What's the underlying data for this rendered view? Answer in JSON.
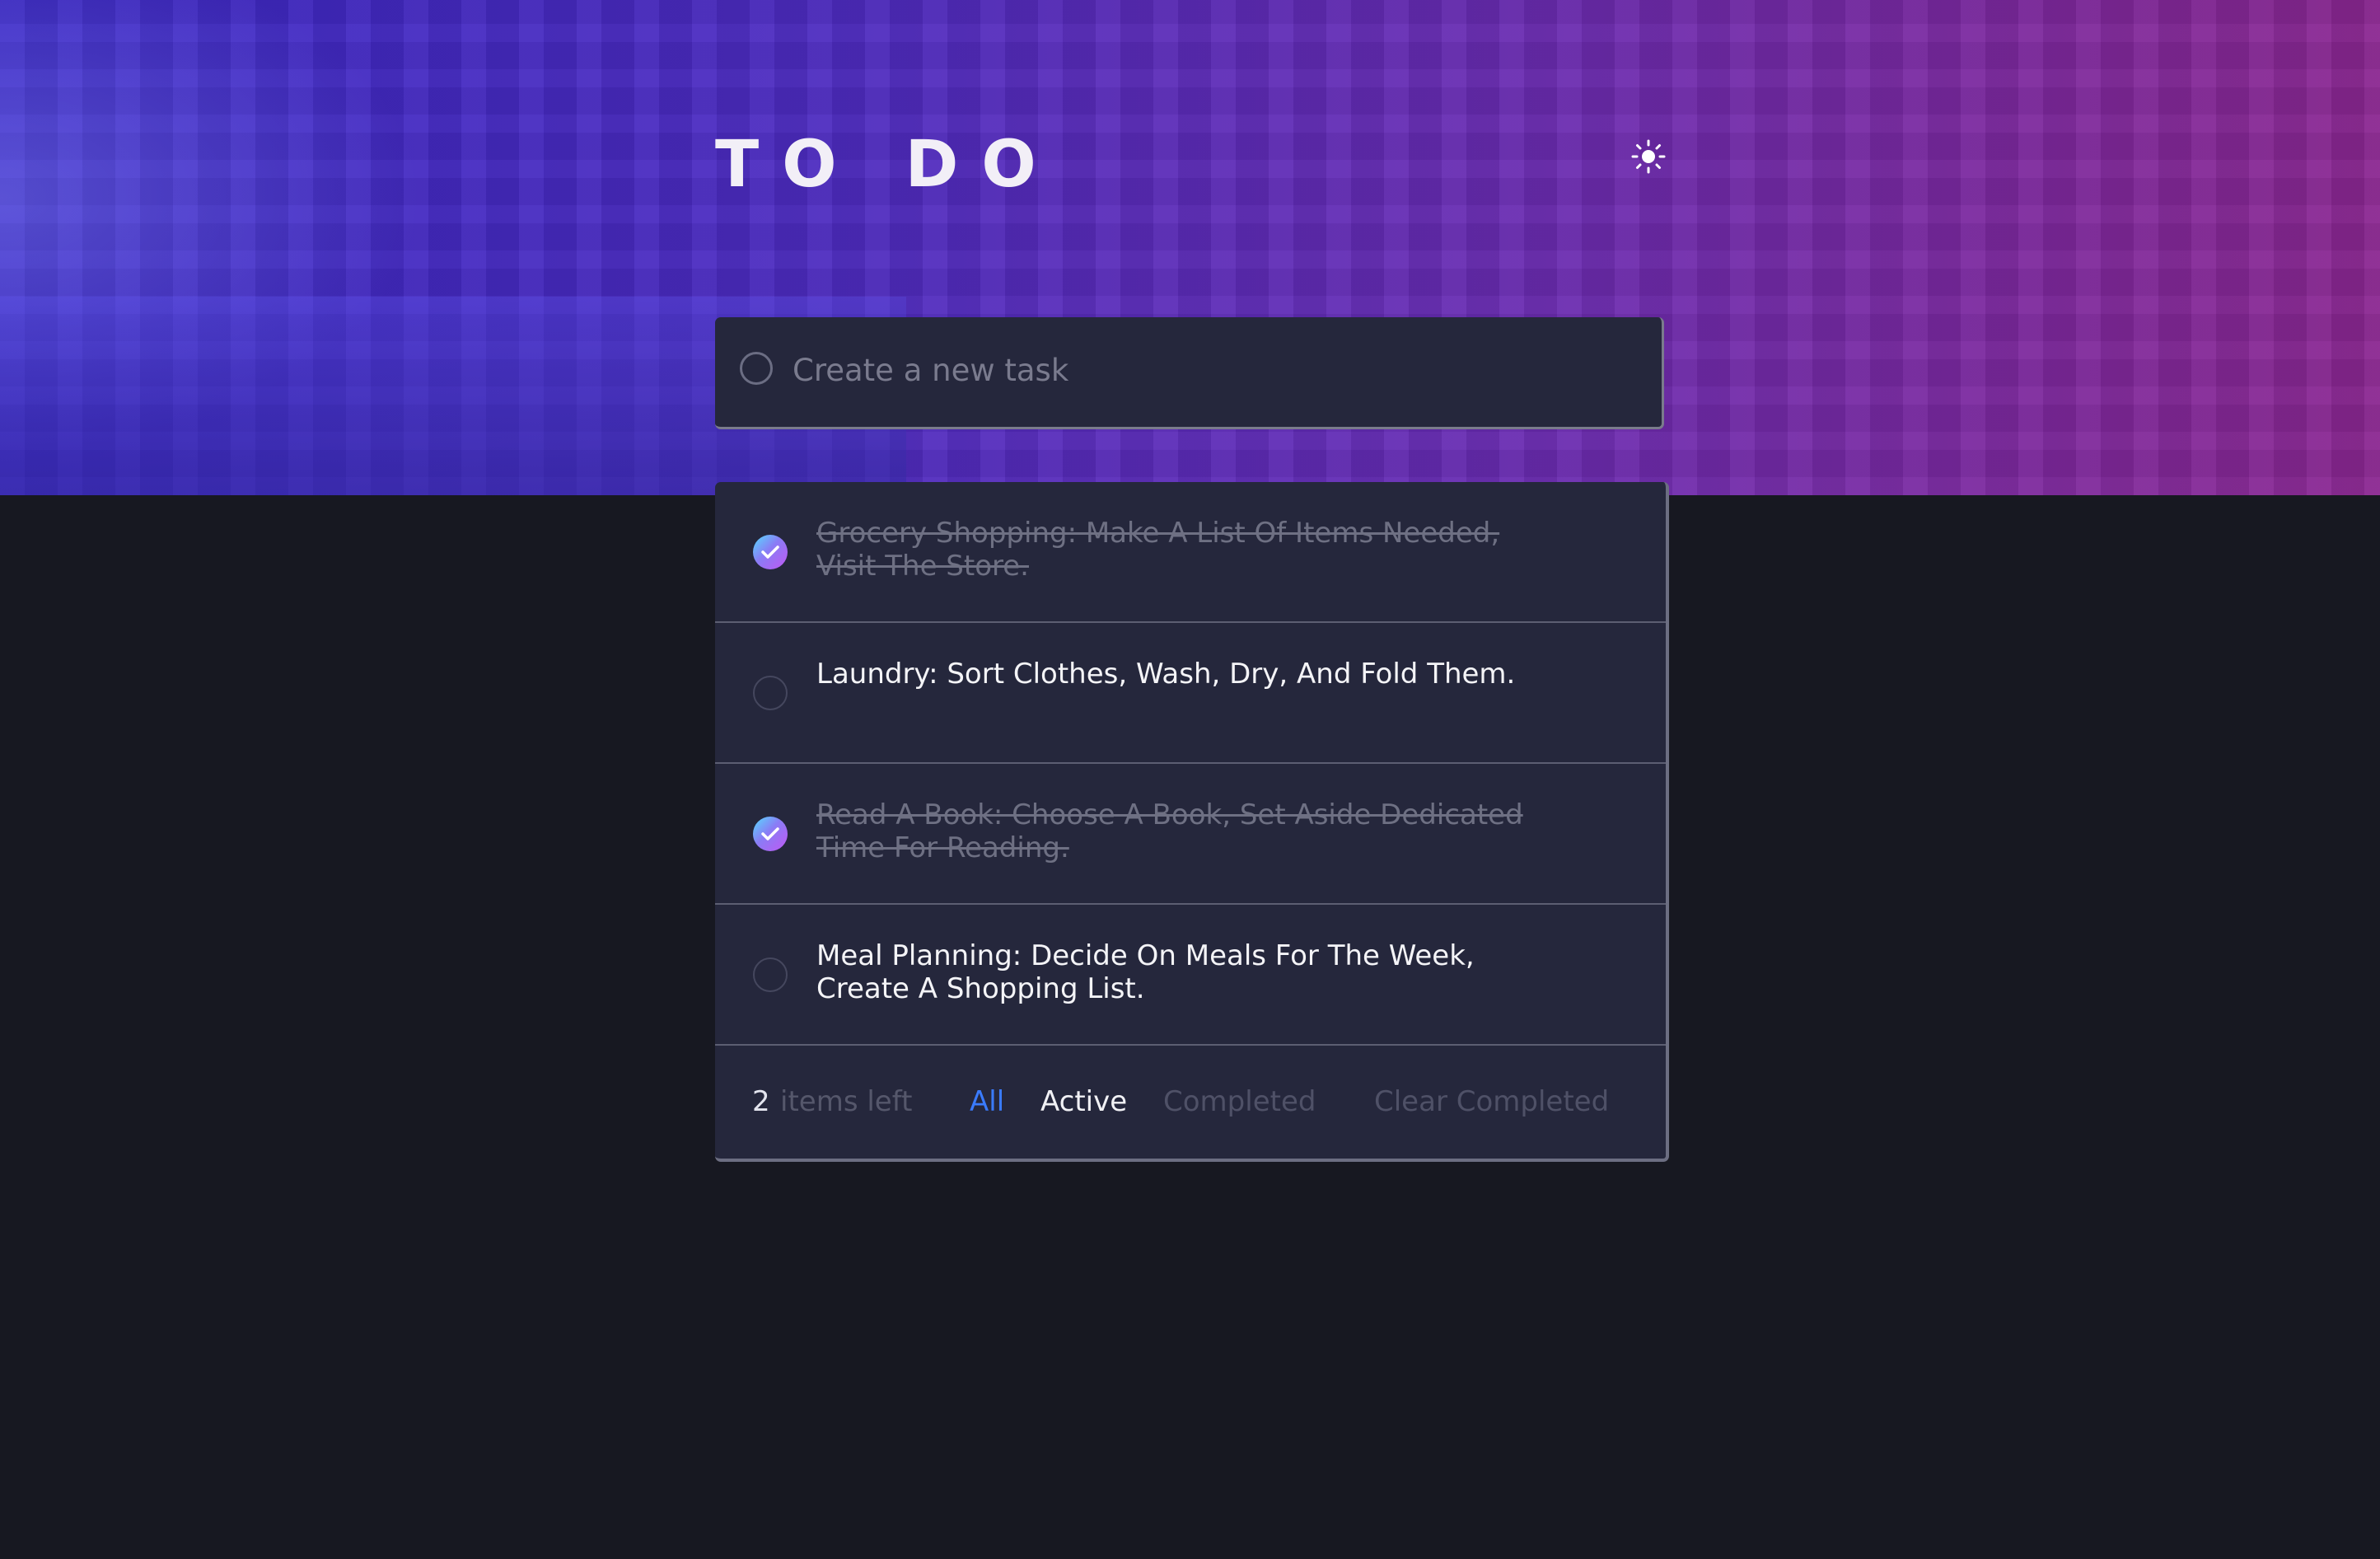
{
  "app": {
    "title": "TO DO",
    "theme_toggle_icon": "sun-icon"
  },
  "new_task": {
    "placeholder": "Create a new task",
    "value": ""
  },
  "todos": [
    {
      "text": "Grocery Shopping: Make A List Of Items Needed, Visit The Store.",
      "completed": true
    },
    {
      "text": "Laundry: Sort Clothes, Wash, Dry, And Fold Them.",
      "completed": false
    },
    {
      "text": "Read A Book: Choose A Book, Set Aside Dedicated Time For Reading.",
      "completed": true
    },
    {
      "text": "Meal Planning: Decide On Meals For The Week, Create A Shopping List.",
      "completed": false
    }
  ],
  "footer": {
    "items_left_count": "2",
    "items_left_label": "items left",
    "filters": {
      "all": "All",
      "active": "Active",
      "completed": "Completed"
    },
    "active_filter": "All",
    "clear_completed": "Clear Completed"
  },
  "colors": {
    "accent": "#3a7bfd",
    "background": "#171821",
    "card": "#25273c",
    "check_gradient_start": "#55ddff",
    "check_gradient_end": "#c058f3"
  }
}
